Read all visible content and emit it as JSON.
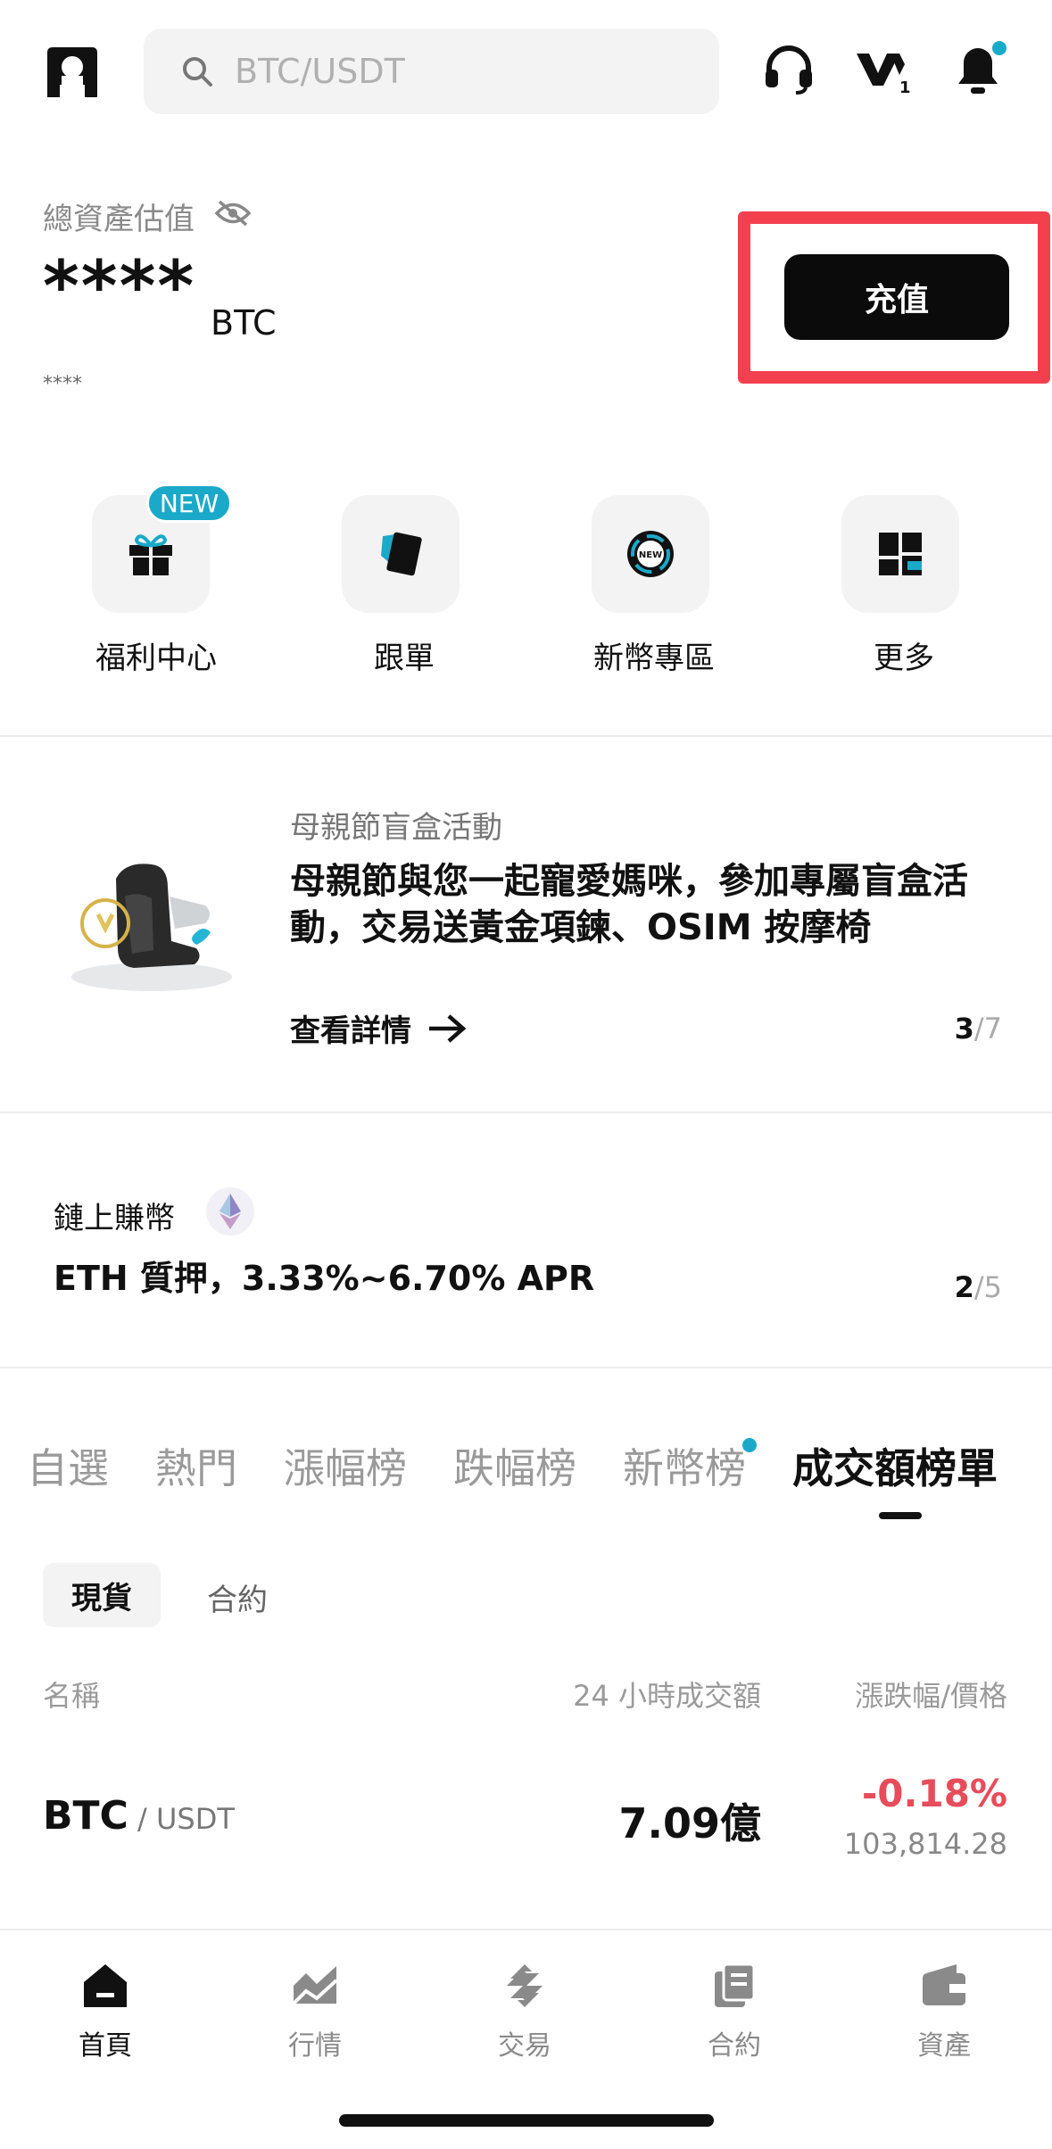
{
  "header": {
    "search_placeholder": "BTC/USDT"
  },
  "assets": {
    "label": "總資產估值",
    "masked_value": "****",
    "unit": "BTC",
    "masked_secondary": "****",
    "deposit_label": "充值"
  },
  "quick_actions": {
    "new_badge": "NEW",
    "items": [
      {
        "label": "福利中心"
      },
      {
        "label": "跟單"
      },
      {
        "label": "新幣專區"
      },
      {
        "label": "更多"
      }
    ]
  },
  "banner": {
    "tag": "母親節盲盒活動",
    "title": "母親節與您一起寵愛媽咪，參加專屬盲盒活動，交易送黃金項鍊、OSIM 按摩椅",
    "link": "查看詳情",
    "counter_current": "3",
    "counter_total": "/7"
  },
  "onchain": {
    "label": "鏈上賺幣",
    "title": "ETH 質押，3.33%~6.70% APR",
    "counter_current": "2",
    "counter_total": "/5"
  },
  "market_tabs": [
    {
      "label": "自選"
    },
    {
      "label": "熱門"
    },
    {
      "label": "漲幅榜"
    },
    {
      "label": "跌幅榜"
    },
    {
      "label": "新幣榜"
    },
    {
      "label": "成交額榜單"
    }
  ],
  "sub_tabs": {
    "selected": "現貨",
    "other": "合約"
  },
  "table": {
    "headers": {
      "name": "名稱",
      "volume": "24 小時成交額",
      "change_price": "漲跌幅/價格"
    },
    "rows": [
      {
        "base": "BTC",
        "quote": " / USDT",
        "volume": "7.09億",
        "change": "-0.18%",
        "price": "103,814.28"
      }
    ]
  },
  "bottom_nav": [
    {
      "label": "首頁"
    },
    {
      "label": "行情"
    },
    {
      "label": "交易"
    },
    {
      "label": "合約"
    },
    {
      "label": "資產"
    }
  ],
  "colors": {
    "accent": "#1aa9c9",
    "negative": "#e74c5a",
    "highlight": "#f2404f"
  }
}
